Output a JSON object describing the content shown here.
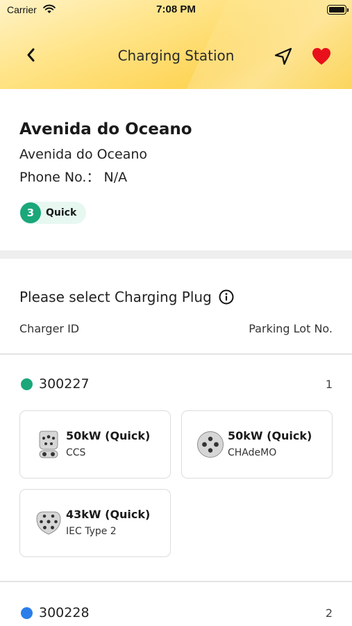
{
  "status_bar": {
    "carrier": "Carrier",
    "time": "7:08 PM"
  },
  "nav": {
    "title": "Charging Station",
    "back_icon": "chevron-left-icon",
    "navigate_icon": "navigation-arrow-icon",
    "favorite_icon": "heart-icon"
  },
  "colors": {
    "header_yellow": "#fbd24f",
    "favorite_red": "#e8101a",
    "quick_green": "#1aa779",
    "dot_green": "#1aa779",
    "dot_blue": "#2b7de9"
  },
  "station": {
    "name": "Avenida do Oceano",
    "address": "Avenida do Oceano",
    "phone": "Phone No.：  N/A",
    "quick_count": "3",
    "quick_label": "Quick"
  },
  "select": {
    "title": "Please select Charging Plug",
    "info_icon": "info-icon"
  },
  "columns": {
    "left": "Charger ID",
    "right": "Parking Lot No."
  },
  "chargers": [
    {
      "id": "300227",
      "lot": "1",
      "plugs": [
        {
          "power": "50kW (Quick)",
          "type": "CCS",
          "icon": "ccs-plug-icon"
        },
        {
          "power": "50kW (Quick)",
          "type": "CHAdeMO",
          "icon": "chademo-plug-icon"
        },
        {
          "power": "43kW (Quick)",
          "type": "IEC Type 2",
          "icon": "type2-plug-icon"
        }
      ]
    },
    {
      "id": "300228",
      "lot": "2",
      "plugs": []
    }
  ]
}
